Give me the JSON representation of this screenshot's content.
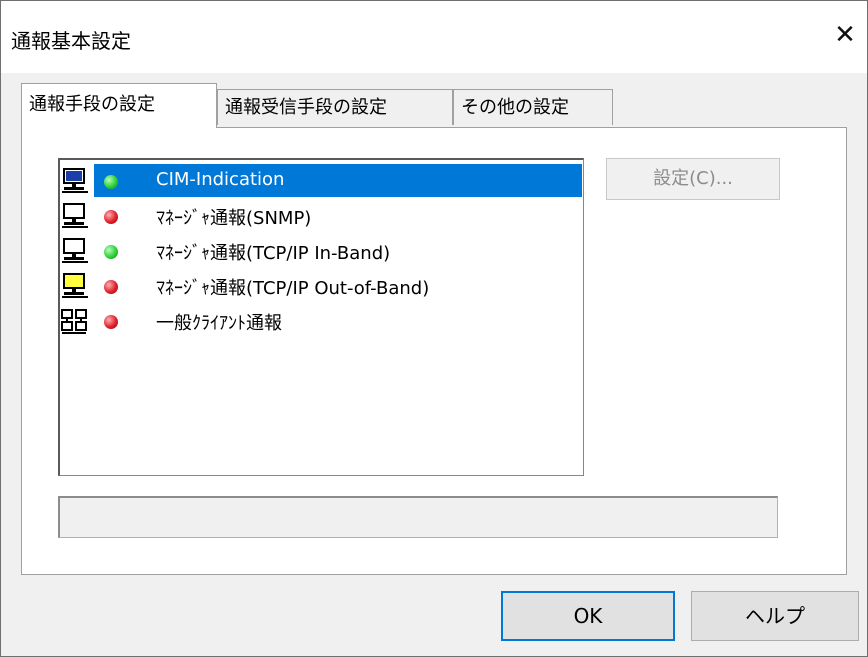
{
  "window": {
    "title": "通報基本設定",
    "close_glyph": "✕"
  },
  "tabs": [
    {
      "label": "通報手段の設定",
      "active": true
    },
    {
      "label": "通報受信手段の設定",
      "active": false
    },
    {
      "label": "その他の設定",
      "active": false
    }
  ],
  "list": {
    "items": [
      {
        "label": "CIM-Indication",
        "status_color": "#2fcf3a",
        "icon": "monitor-icon",
        "selected": true
      },
      {
        "label": "ﾏﾈｰｼﾞｬ通報(SNMP)",
        "status_color": "#e0202a",
        "icon": "monitor-icon",
        "selected": false
      },
      {
        "label": "ﾏﾈｰｼﾞｬ通報(TCP/IP In-Band)",
        "status_color": "#2fcf3a",
        "icon": "monitor-icon",
        "selected": false
      },
      {
        "label": "ﾏﾈｰｼﾞｬ通報(TCP/IP Out-of-Band)",
        "status_color": "#e0202a",
        "icon": "yellow-monitor-icon",
        "selected": false
      },
      {
        "label": "一般ｸﾗｲｱﾝﾄ通報",
        "status_color": "#e0202a",
        "icon": "network-icon",
        "selected": false
      }
    ]
  },
  "settings_button": {
    "label": "設定(C)..."
  },
  "status_field": {
    "text": ""
  },
  "footer": {
    "ok_label": "OK",
    "help_label": "ヘルプ"
  },
  "colors": {
    "selection": "#0078d7",
    "status_green": "#2fcf3a",
    "status_red": "#e0202a"
  }
}
